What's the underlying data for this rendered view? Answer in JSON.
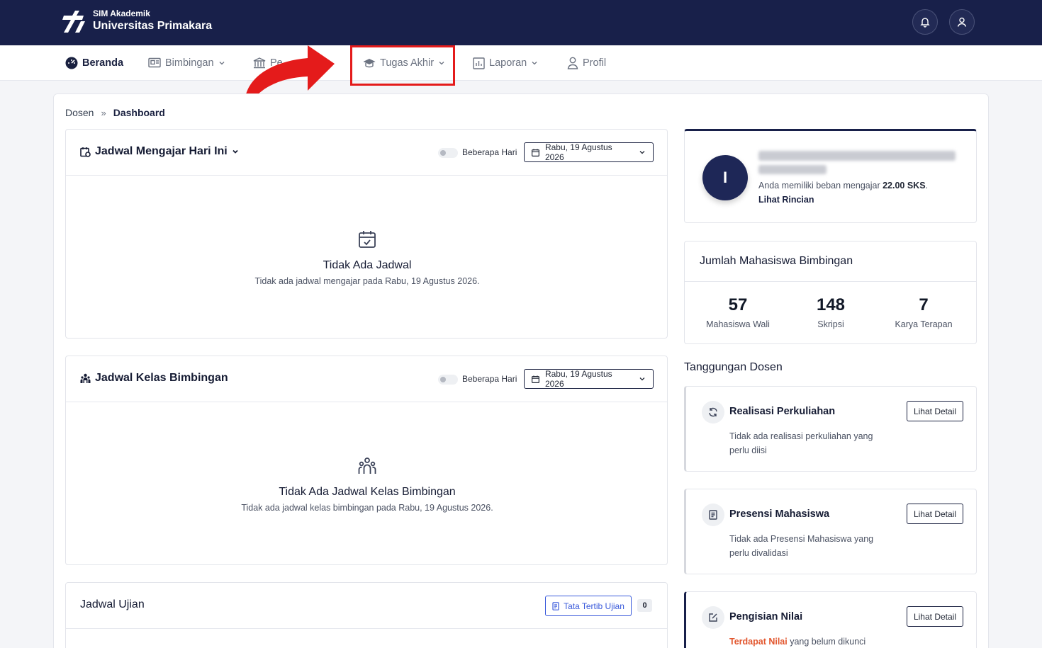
{
  "header": {
    "brand_small": "SIM Akademik",
    "brand_title": "Universitas Primakara",
    "icons": [
      "bell-icon",
      "user-icon"
    ]
  },
  "nav": {
    "items": [
      {
        "label": "Beranda",
        "icon": "dashboard-icon",
        "active": true
      },
      {
        "label": "Bimbingan",
        "icon": "board-icon"
      },
      {
        "label": "Pe",
        "icon": "institution-icon"
      },
      {
        "label": "Tugas Akhir",
        "icon": "graduation-cap-icon"
      },
      {
        "label": "Laporan",
        "icon": "report-icon"
      },
      {
        "label": "Profil",
        "icon": "user-icon"
      }
    ]
  },
  "annotation": {
    "color": "#e41b1b",
    "highlighted": "Tugas Akhir"
  },
  "breadcrumb": {
    "root": "Dosen",
    "separator": "»",
    "current": "Dashboard"
  },
  "schedule": {
    "title": "Jadwal Mengajar Hari Ini",
    "toggle_label": "Beberapa Hari",
    "date": "Rabu, 19 Agustus 2026",
    "empty_title": "Tidak Ada Jadwal",
    "empty_desc": "Tidak ada jadwal mengajar pada Rabu, 19 Agustus 2026."
  },
  "guidance": {
    "title": "Jadwal Kelas Bimbingan",
    "toggle_label": "Beberapa Hari",
    "date": "Rabu, 19 Agustus 2026",
    "empty_title": "Tidak Ada Jadwal Kelas Bimbingan",
    "empty_desc": "Tidak ada jadwal kelas bimbingan pada Rabu, 19 Agustus 2026."
  },
  "exam": {
    "title": "Jadwal Ujian",
    "rules_button": "Tata Tertib Ujian",
    "count": "0"
  },
  "profile": {
    "avatar_initial": "I",
    "load_prefix": "Anda memiliki beban mengajar ",
    "load_value": "22.00 SKS",
    "load_suffix": ".",
    "detail_link": "Lihat Rincian"
  },
  "students": {
    "title": "Jumlah Mahasiswa Bimbingan",
    "stats": [
      {
        "value": "57",
        "label": "Mahasiswa Wali"
      },
      {
        "value": "148",
        "label": "Skripsi"
      },
      {
        "value": "7",
        "label": "Karya Terapan"
      }
    ]
  },
  "duties": {
    "title": "Tanggungan Dosen",
    "button_label": "Lihat Detail",
    "items": [
      {
        "title": "Realisasi Perkuliahan",
        "desc": "Tidak ada realisasi perkuliahan yang perlu diisi",
        "icon": "refresh-icon"
      },
      {
        "title": "Presensi Mahasiswa",
        "desc": "Tidak ada Presensi Mahasiswa yang perlu divalidasi",
        "icon": "document-icon"
      },
      {
        "title": "Pengisian Nilai",
        "desc_highlight": "Terdapat Nilai",
        "desc_rest": " yang belum dikunci",
        "icon": "edit-icon"
      }
    ]
  }
}
